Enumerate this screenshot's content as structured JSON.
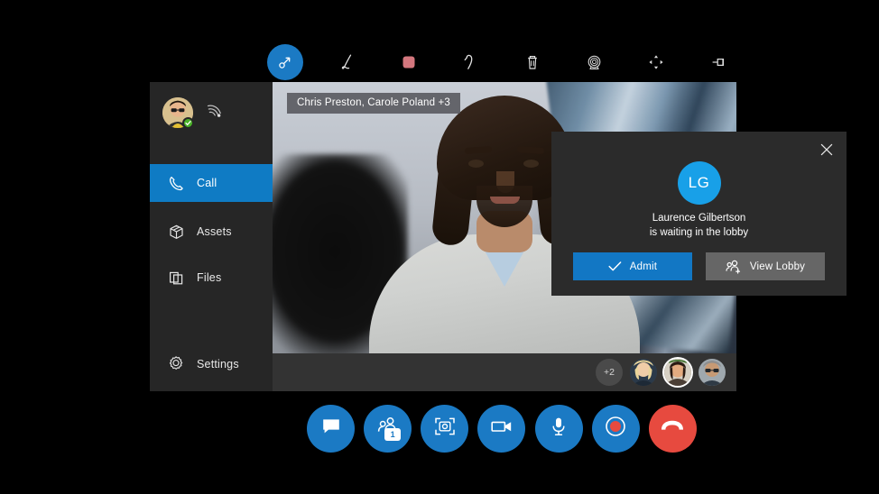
{
  "theme": {
    "background": "#000000",
    "accent_blue": "#0f7bc4",
    "control_blue": "#1b7ac4",
    "danger_red": "#e74a3f",
    "panel_dark": "#2b2b2b",
    "sidebar_dark": "#262626",
    "filmstrip_gray": "#333333",
    "lobby_avatar_blue": "#18a0e8",
    "presence_green": "#4ab328",
    "ink_swatch_red": "#d4777e"
  },
  "annotation_toolbar": {
    "tools": [
      {
        "name": "laser-pointer",
        "label": "Laser Pointer",
        "active": true
      },
      {
        "name": "pen",
        "label": "Pen",
        "active": false
      },
      {
        "name": "color-swatch",
        "label": "Color",
        "active": false,
        "color": "#d4777e"
      },
      {
        "name": "undo",
        "label": "Undo",
        "active": false
      },
      {
        "name": "delete",
        "label": "Delete",
        "active": false
      },
      {
        "name": "stamp",
        "label": "Stamp",
        "active": false
      },
      {
        "name": "move",
        "label": "Move",
        "active": false
      },
      {
        "name": "pin",
        "label": "Pin",
        "active": false
      }
    ]
  },
  "sidebar": {
    "profile": {
      "avatar_alt": "My avatar",
      "presence": "Available",
      "signal_icon": "signal-icon"
    },
    "items": [
      {
        "id": "call",
        "label": "Call",
        "icon": "phone-icon",
        "selected": true
      },
      {
        "id": "assets",
        "label": "Assets",
        "icon": "cube-icon",
        "selected": false
      },
      {
        "id": "files",
        "label": "Files",
        "icon": "files-icon",
        "selected": false
      },
      {
        "id": "settings",
        "label": "Settings",
        "icon": "gear-icon",
        "selected": false
      }
    ]
  },
  "stage": {
    "name_tag": "Chris Preston, Carole Poland +3",
    "filmstrip": {
      "overflow_count": "+2",
      "participants": [
        {
          "id": "p1",
          "speaking": false
        },
        {
          "id": "p2",
          "speaking": true
        },
        {
          "id": "p3",
          "speaking": false
        }
      ]
    }
  },
  "lobby_card": {
    "close_label": "Close",
    "avatar_initials": "LG",
    "person_name": "Laurence Gilbertson",
    "status_line": "is waiting in the lobby",
    "admit_label": "Admit",
    "view_lobby_label": "View Lobby"
  },
  "call_controls": [
    {
      "id": "chat",
      "name": "chat-button",
      "label": "Chat",
      "style": "blue"
    },
    {
      "id": "add-people",
      "name": "add-people-button",
      "label": "Add people",
      "style": "blue",
      "badge": "1"
    },
    {
      "id": "capture",
      "name": "capture-button",
      "label": "Capture",
      "style": "blue"
    },
    {
      "id": "video",
      "name": "video-button",
      "label": "Video",
      "style": "blue"
    },
    {
      "id": "mic",
      "name": "microphone-button",
      "label": "Microphone",
      "style": "blue"
    },
    {
      "id": "record",
      "name": "record-button",
      "label": "Record",
      "style": "blue"
    },
    {
      "id": "end-call",
      "name": "end-call-button",
      "label": "End call",
      "style": "red"
    }
  ]
}
